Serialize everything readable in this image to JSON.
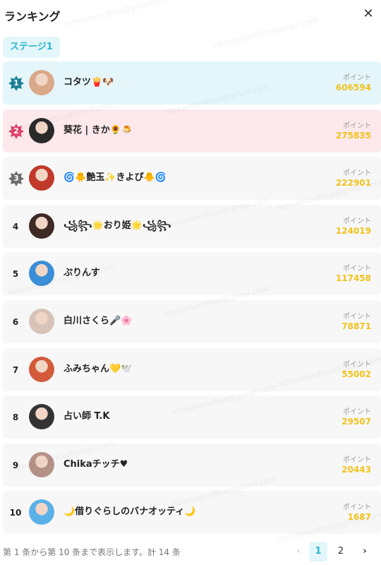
{
  "header": {
    "title": "ランキング",
    "close_label": "✕"
  },
  "stage_tab": "ステージ1",
  "watermark": "rstreameroffice@gmail.com",
  "point_label": "ポイント",
  "rows": [
    {
      "rank": "1",
      "name": "コタツ🍟🐶",
      "points": "606594",
      "avatar_color": "#d9a98a"
    },
    {
      "rank": "2",
      "name": "葵花 | きか🌻🍮",
      "points": "275835",
      "avatar_color": "#2a2a2a"
    },
    {
      "rank": "3",
      "name": "🌀🐥艶玉✨きよぴ🐥🌀",
      "points": "222901",
      "avatar_color": "#c0392b"
    },
    {
      "rank": "4",
      "name": "꧁꧂🌟おり姫🌟꧁꧂",
      "points": "124019",
      "avatar_color": "#3d2a24"
    },
    {
      "rank": "5",
      "name": "ぷりんす",
      "points": "117458",
      "avatar_color": "#3b8ed8"
    },
    {
      "rank": "6",
      "name": "白川さくら🎤🌸",
      "points": "78871",
      "avatar_color": "#d8c3b8"
    },
    {
      "rank": "7",
      "name": "ふみちゃん💛🕊️",
      "points": "55002",
      "avatar_color": "#d35b3c"
    },
    {
      "rank": "8",
      "name": "占い師 T.K",
      "points": "29507",
      "avatar_color": "#333333"
    },
    {
      "rank": "9",
      "name": "Chikaチッチ♥",
      "points": "20443",
      "avatar_color": "#b59288"
    },
    {
      "rank": "10",
      "name": "🌙借りぐらしのバナオッティ🌙",
      "points": "1687",
      "avatar_color": "#5ab1e8"
    }
  ],
  "badge_colors": {
    "1": "#1b7f95",
    "2": "#e0436d",
    "3": "#6b6b6b"
  },
  "footer": {
    "summary": "第 1 条から第 10 条まで表示します。計 14 条",
    "prev": "‹",
    "page1": "1",
    "page2": "2",
    "next": "›"
  }
}
